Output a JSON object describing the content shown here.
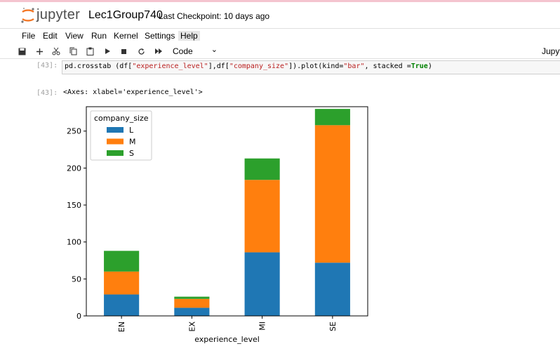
{
  "app": {
    "logo_text": "jupyter",
    "notebook_title": "Lec1Group740",
    "checkpoint": "Last Checkpoint: 10 days ago",
    "kernel_label": "Jupyt"
  },
  "menu": [
    "File",
    "Edit",
    "View",
    "Run",
    "Kernel",
    "Settings",
    "Help"
  ],
  "toolbar": {
    "icons": [
      "save-icon",
      "add-cell-icon",
      "cut-icon",
      "copy-icon",
      "paste-icon",
      "run-icon",
      "stop-icon",
      "restart-icon",
      "run-all-icon"
    ],
    "cell_type": "Code"
  },
  "cell": {
    "in_prompt": "[43]:",
    "out_prompt": "[43]:",
    "code_before": "pd.crosstab (df[",
    "str1": "\"experience_level\"",
    "code_mid": "],df[",
    "str2": "\"company_size\"",
    "code_mid2": "]).plot(kind=",
    "str3": "\"bar\"",
    "code_mid3": ", stacked =",
    "kw_true": "True",
    "code_end": ")",
    "output_text": "<Axes: xlabel='experience_level'>"
  },
  "chart_data": {
    "type": "bar",
    "stacked": true,
    "categories": [
      "EN",
      "EX",
      "MI",
      "SE"
    ],
    "series": [
      {
        "name": "L",
        "values": [
          29,
          11,
          86,
          72
        ],
        "color": "#1f77b4"
      },
      {
        "name": "M",
        "values": [
          31,
          12,
          98,
          186
        ],
        "color": "#ff7f0e"
      },
      {
        "name": "S",
        "values": [
          28,
          3,
          29,
          22
        ],
        "color": "#2ca02c"
      }
    ],
    "xlabel": "experience_level",
    "ylabel": "",
    "ylim": [
      0,
      283
    ],
    "yticks": [
      0,
      50,
      100,
      150,
      200,
      250
    ],
    "legend_title": "company_size",
    "legend_position": "upper-left",
    "grid": false
  }
}
